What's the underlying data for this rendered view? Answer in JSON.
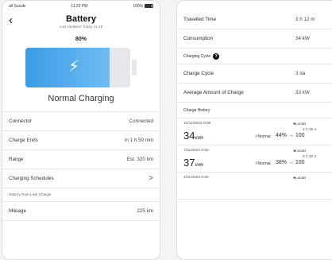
{
  "left": {
    "status": {
      "carrier": "all Suzuki",
      "time": "11:23 PM",
      "battery": "100%"
    },
    "header": {
      "back_icon": "chevron-left-icon",
      "title": "Battery",
      "subtitle": "Last Updated: Today, 11:29"
    },
    "battery": {
      "percent_label": "80%",
      "level": 0.8,
      "status": "Normal Charging",
      "fill_color": "#3a9de6"
    },
    "rows": [
      {
        "label": "Connector",
        "value": "Connected"
      },
      {
        "label": "Charge Ends",
        "value": "in 1 h 50 min"
      },
      {
        "label": "Range",
        "value": "Est. 320 km"
      },
      {
        "label": "Charging Schedules",
        "value": ">"
      }
    ],
    "history_section": "History from Last Charge",
    "mileage": {
      "label": "Mileage",
      "value": "225 km"
    }
  },
  "right": {
    "rows": [
      {
        "label": "Travelled Time",
        "value": "3 h 12 m"
      },
      {
        "label": "Consumption",
        "value": "34 kW"
      }
    ],
    "charging_cycle_label": "Charging Cycle",
    "charge_cycle": {
      "label": "Charge Cycle",
      "value": "3 da"
    },
    "average_charge": {
      "label": "Average Amount of Charge",
      "value": "33 kW"
    },
    "history_label": "Charge History",
    "history": [
      {
        "date": "10/11/2024 0:00",
        "energy": "34",
        "unit": "kWh",
        "location": "Locati",
        "duration": "4 h 28 n",
        "mode": "Normal",
        "range": "44% → 100"
      },
      {
        "date": "7/11/2024 0:00",
        "energy": "37",
        "unit": "kWh",
        "location": "Locati",
        "duration": "5 h 30 n",
        "mode": "Normal",
        "range": "38% → 100"
      },
      {
        "date": "4/11/2024 0:00",
        "energy": "",
        "unit": "",
        "location": "Locati",
        "duration": "",
        "mode": "",
        "range": ""
      }
    ]
  }
}
